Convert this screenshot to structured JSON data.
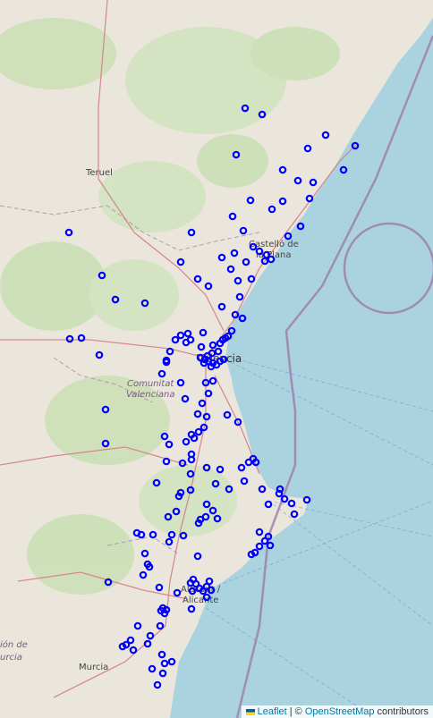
{
  "map": {
    "colors": {
      "land": "#eae6dc",
      "water": "#aad3df",
      "forest": "#c8dfb2",
      "marker": "#0000ff",
      "road": "#c9696f",
      "border": "#9e7ba9"
    },
    "places": [
      {
        "name": "Teruel",
        "label": "Teruel"
      },
      {
        "name": "Castello",
        "label": "Castelló de"
      },
      {
        "name": "Castello2",
        "label": "la Plana"
      },
      {
        "name": "Valencia",
        "label": "València"
      },
      {
        "name": "Comunitat",
        "label": "Comunitat"
      },
      {
        "name": "Comunitat2",
        "label": "Valenciana"
      },
      {
        "name": "Alacant",
        "label": "Alacant /"
      },
      {
        "name": "Alicante",
        "label": "Alicante"
      },
      {
        "name": "Murcia",
        "label": "Murcia"
      },
      {
        "name": "RegionMurcia",
        "label": "ión de"
      },
      {
        "name": "RegionMurcia2",
        "label": "urcia"
      }
    ],
    "marker_icon": "circle-marker-icon"
  },
  "attribution": {
    "leaflet": "Leaflet",
    "separator": " | © ",
    "osm": "OpenStreetMap",
    "contributors": " contributors"
  }
}
